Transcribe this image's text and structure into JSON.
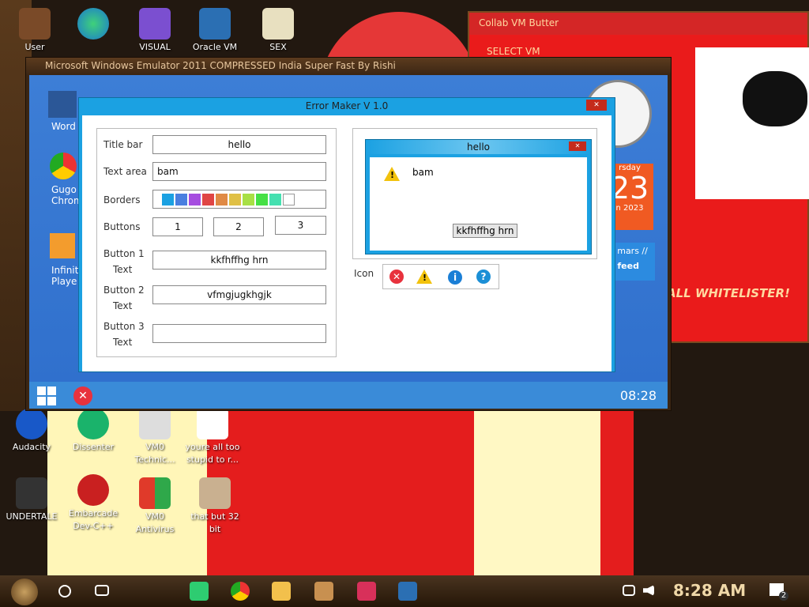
{
  "desktop_icons": [
    {
      "label": "User",
      "icon": "user-folder-icon"
    },
    {
      "label": "",
      "icon": "edge-icon"
    },
    {
      "label": "VISUAL",
      "icon": "visual-studio-icon"
    },
    {
      "label": "Oracle VM",
      "icon": "virtualbox-icon"
    },
    {
      "label": "SEX",
      "icon": "hxd-icon"
    },
    {
      "label": "Audacity",
      "icon": "audacity-icon"
    },
    {
      "label": "Dissenter",
      "icon": "dissenter-icon"
    },
    {
      "label": "VM0 Technic...",
      "icon": "vm0-icon"
    },
    {
      "label": "youre all too stupid to r...",
      "icon": "image-icon"
    },
    {
      "label": "UNDERTALE",
      "icon": "unity-icon"
    },
    {
      "label": "Embarcade Dev-C++",
      "icon": "devcpp-icon"
    },
    {
      "label": "VM0 Antivirus",
      "icon": "shield-icon"
    },
    {
      "label": "that but 32 bit",
      "icon": "image-icon"
    }
  ],
  "collab": {
    "title": "Collab VM Butter",
    "select": "SELECT VM",
    "whitelist": "ALL WHITELISTER!"
  },
  "emu": {
    "title": "Microsoft Windows Emulator 2011 COMPRESSED India Super Fast By Rishi",
    "clock": "08:28",
    "side_items": [
      "Word",
      "Gugo Chromi",
      "Infinit Playe"
    ],
    "widget_day": "rsday",
    "widget_date": "23",
    "widget_year": "n 2023",
    "link1": "o mars //",
    "link2": "s feed"
  },
  "dialog": {
    "title": "Error Maker V 1.0",
    "labels": {
      "title_bar": "Title bar",
      "text_area": "Text area",
      "borders": "Borders",
      "buttons": "Buttons",
      "b1a": "Button 1",
      "b1b": "Text",
      "b2a": "Button 2",
      "b2b": "Text",
      "b3a": "Button 3",
      "b3b": "Text",
      "icon": "Icon"
    },
    "values": {
      "title_bar": "hello",
      "text_area": "bam",
      "btn1": "1",
      "btn2": "2",
      "btn3": "3",
      "button1_text": "kkfhffhg hrn",
      "button2_text": "vfmgjugkhgjk",
      "button3_text": ""
    },
    "border_colors": [
      "#1ba1e2",
      "#4a7fe0",
      "#a64de0",
      "#e04545",
      "#e08a45",
      "#e0c045",
      "#a8e045",
      "#45e045",
      "#45e0b0",
      "#ffffff"
    ],
    "preview": {
      "title": "hello",
      "message": "bam",
      "button": "kkfhffhg hrn"
    }
  },
  "taskbar": {
    "time": "8:28 AM",
    "notif": "2"
  }
}
